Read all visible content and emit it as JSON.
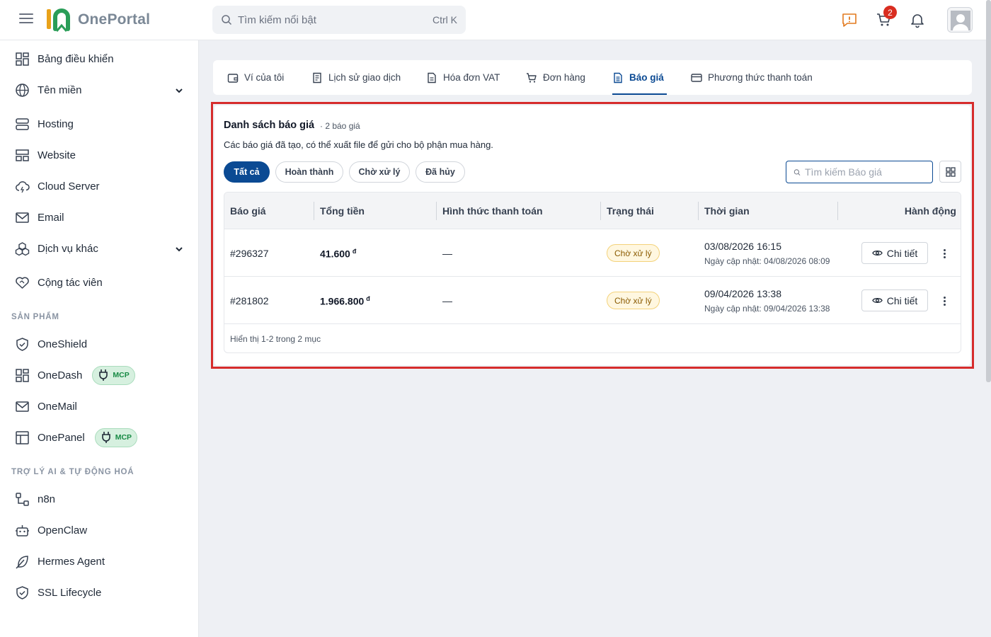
{
  "header": {
    "brand": "OnePortal",
    "search_placeholder": "Tìm kiếm nổi bật",
    "search_shortcut": "Ctrl K",
    "cart_count": "2"
  },
  "sidebar": {
    "items": [
      {
        "label": "Bảng điều khiển",
        "icon": "dashboard-icon"
      },
      {
        "label": "Tên miền",
        "icon": "globe-icon"
      },
      {
        "label": "Hosting",
        "icon": "server-icon"
      },
      {
        "label": "Website",
        "icon": "website-icon"
      },
      {
        "label": "Cloud Server",
        "icon": "cloud-icon"
      },
      {
        "label": "Email",
        "icon": "mail-icon"
      },
      {
        "label": "Dịch vụ khác",
        "icon": "boxes-icon"
      },
      {
        "label": "Cộng tác viên",
        "icon": "handshake-icon"
      }
    ],
    "section_products": "SẢN PHẨM",
    "products": [
      {
        "label": "OneShield",
        "icon": "shield-icon"
      },
      {
        "label": "OneDash",
        "icon": "dashboard-icon",
        "badge": "MCP"
      },
      {
        "label": "OneMail",
        "icon": "mail-icon"
      },
      {
        "label": "OnePanel",
        "icon": "panel-icon",
        "badge": "MCP"
      }
    ],
    "section_ai": "TRỢ LÝ AI & TỰ ĐỘNG HOÁ",
    "ai": [
      {
        "label": "n8n",
        "icon": "workflow-icon"
      },
      {
        "label": "OpenClaw",
        "icon": "bot-icon"
      },
      {
        "label": "Hermes Agent",
        "icon": "feather-icon"
      },
      {
        "label": "SSL Lifecycle",
        "icon": "shield-check-icon"
      }
    ]
  },
  "tabs": [
    {
      "label": "Ví của tôi",
      "icon": "wallet-icon"
    },
    {
      "label": "Lịch sử giao dịch",
      "icon": "receipt-icon"
    },
    {
      "label": "Hóa đơn VAT",
      "icon": "file-icon"
    },
    {
      "label": "Đơn hàng",
      "icon": "cart-icon"
    },
    {
      "label": "Báo giá",
      "icon": "quote-file-icon",
      "active": true
    },
    {
      "label": "Phương thức thanh toán",
      "icon": "card-icon"
    }
  ],
  "quotes": {
    "title": "Danh sách báo giá",
    "count": "· 2 báo giá",
    "description": "Các báo giá đã tạo, có thể xuất file để gửi cho bộ phận mua hàng.",
    "filters": [
      "Tất cả",
      "Hoàn thành",
      "Chờ xử lý",
      "Đã hủy"
    ],
    "active_filter": "Tất cả",
    "search_placeholder": "Tìm kiếm Báo giá",
    "columns": [
      "Báo giá",
      "Tổng tiền",
      "Hình thức thanh toán",
      "Trạng thái",
      "Thời gian",
      "Hành động"
    ],
    "currency": "đ",
    "rows": [
      {
        "id": "#296327",
        "amount": "41.600",
        "payment": "—",
        "status": "Chờ xử lý",
        "time": "03/08/2026 16:15",
        "updated": "Ngày cập nhật: 04/08/2026 08:09",
        "action": "Chi tiết"
      },
      {
        "id": "#281802",
        "amount": "1.966.800",
        "payment": "—",
        "status": "Chờ xử lý",
        "time": "09/04/2026 13:38",
        "updated": "Ngày cập nhật: 09/04/2026 13:38",
        "action": "Chi tiết"
      }
    ],
    "footer": "Hiển thị 1-2 trong 2 mục"
  },
  "colors": {
    "primary": "#0b4a93",
    "highlight_border": "#d62c2c",
    "pending_badge": "#fff7e0",
    "mcp_badge": "#d6f0df"
  }
}
